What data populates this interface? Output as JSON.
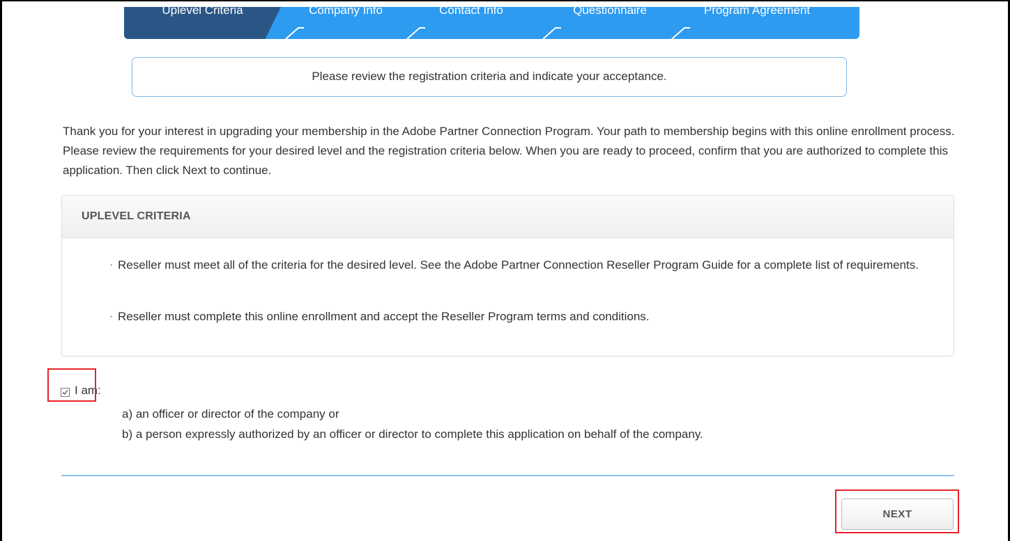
{
  "steps": [
    {
      "label": "Uplevel Criteria",
      "active": true
    },
    {
      "label": "Company Info",
      "active": false
    },
    {
      "label": "Contact Info",
      "active": false
    },
    {
      "label": "Questionnaire",
      "active": false
    },
    {
      "label": "Program Agreement",
      "active": false
    }
  ],
  "info_message": "Please review the registration criteria and indicate your acceptance.",
  "intro_text": "Thank you for your interest in upgrading your membership in the Adobe Partner Connection Program. Your path to membership begins with this online enrollment process. Please review the requirements for your desired level and the registration criteria below. When you are ready to proceed, confirm that you are authorized to complete this application. Then click Next to continue.",
  "criteria": {
    "title": "UPLEVEL CRITERIA",
    "items": [
      "Reseller must meet all of the criteria for the desired level. See the Adobe Partner Connection Reseller Program Guide for a complete list of requirements.",
      "Reseller must complete this online enrollment and accept the Reseller Program terms and conditions."
    ]
  },
  "authorization": {
    "checked": true,
    "label": "I am:",
    "options": [
      "a) an officer or director of the company or",
      "b) a person expressly authorized by an officer or director to complete this application on behalf of the company."
    ]
  },
  "next_label": "NEXT",
  "colors": {
    "active_step": "#2a5686",
    "step_bar": "#2d9bf0",
    "highlight": "#e8212a",
    "divider": "#8cc3ee"
  }
}
